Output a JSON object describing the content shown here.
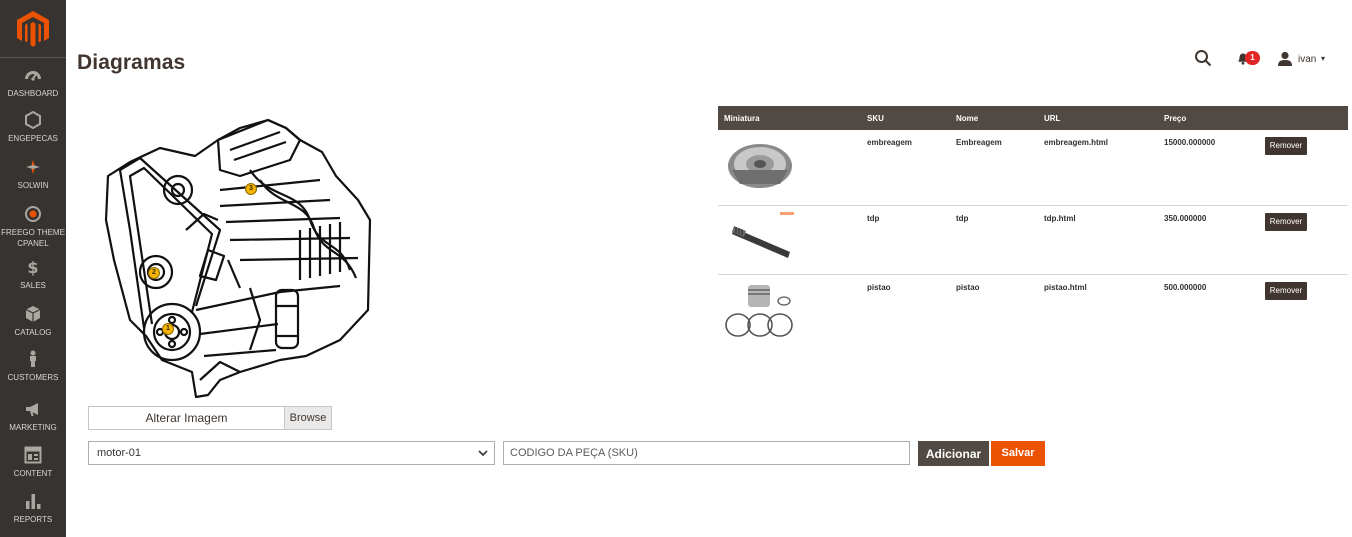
{
  "sidebar": {
    "items": [
      {
        "label": "DASHBOARD",
        "icon": "dashboard-icon"
      },
      {
        "label": "ENGEPECAS",
        "icon": "hexagon-icon"
      },
      {
        "label": "SOLWIN",
        "icon": "solwin-icon"
      },
      {
        "label": "FREEGO THEME CPANEL",
        "icon": "target-icon"
      },
      {
        "label": "SALES",
        "icon": "dollar-icon"
      },
      {
        "label": "CATALOG",
        "icon": "box-icon"
      },
      {
        "label": "CUSTOMERS",
        "icon": "person-icon"
      },
      {
        "label": "MARKETING",
        "icon": "megaphone-icon"
      },
      {
        "label": "CONTENT",
        "icon": "layout-icon"
      },
      {
        "label": "REPORTS",
        "icon": "bar-chart-icon"
      }
    ]
  },
  "header": {
    "title": "Diagramas",
    "notification_count": "1",
    "user_name": "ivan"
  },
  "diagram": {
    "pins": [
      "1",
      "2",
      "3"
    ]
  },
  "form": {
    "file_label": "Alterar Imagem",
    "browse_label": "Browse",
    "select_value": "motor-01",
    "sku_placeholder": "CODIGO DA PEÇA (SKU)",
    "add_label": "Adicionar",
    "save_label": "Salvar"
  },
  "table": {
    "columns": [
      "Miniatura",
      "SKU",
      "Nome",
      "URL",
      "Preço"
    ],
    "rows": [
      {
        "sku": "embreagem",
        "name": "Embreagem",
        "url": "embreagem.html",
        "price": "15000.000000",
        "action": "Remover"
      },
      {
        "sku": "tdp",
        "name": "tdp",
        "url": "tdp.html",
        "price": "350.000000",
        "action": "Remover"
      },
      {
        "sku": "pistao",
        "name": "pistao",
        "url": "pistao.html",
        "price": "500.000000",
        "action": "Remover"
      }
    ]
  },
  "colors": {
    "sidebar": "#373330",
    "brand": "#eb5202",
    "table_header": "#514943",
    "badge": "#e22626"
  }
}
